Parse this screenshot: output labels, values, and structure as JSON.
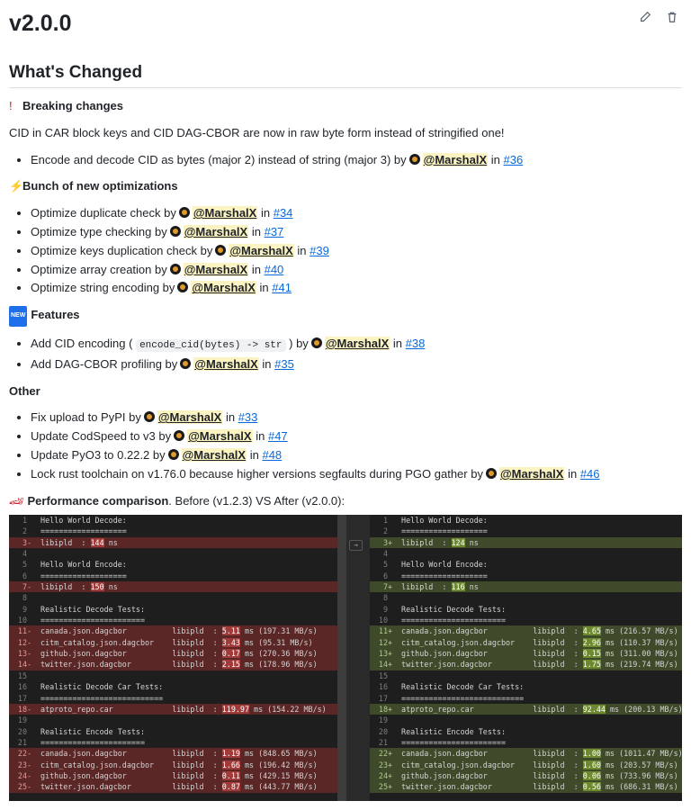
{
  "release": {
    "title": "v2.0.0"
  },
  "changes": {
    "heading": "What's Changed",
    "breaking": {
      "icon": "!",
      "title": "Breaking changes",
      "note": "CID in CAR block keys and CID DAG-CBOR are now in raw byte form instead of stringified one!",
      "items": [
        {
          "text": "Encode and decode CID as bytes (major 2) instead of string (major 3) by",
          "user": "@MarshalX",
          "in": "in",
          "pr": "#36"
        }
      ]
    },
    "optimizations": {
      "icon": "⚡",
      "title": "Bunch of new optimizations",
      "items": [
        {
          "text": "Optimize duplicate check by",
          "user": "@MarshalX",
          "in": "in",
          "pr": "#34"
        },
        {
          "text": "Optimize type checking by",
          "user": "@MarshalX",
          "in": "in",
          "pr": "#37"
        },
        {
          "text": "Optimize keys duplication check by",
          "user": "@MarshalX",
          "in": "in",
          "pr": "#39"
        },
        {
          "text": "Optimize array creation by",
          "user": "@MarshalX",
          "in": "in",
          "pr": "#40"
        },
        {
          "text": "Optimize string encoding by",
          "user": "@MarshalX",
          "in": "in",
          "pr": "#41"
        }
      ]
    },
    "features": {
      "icon": "NEW",
      "title": "Features",
      "items": [
        {
          "text_pre": "Add CID encoding (",
          "code": "encode_cid(bytes) -> str",
          "text_post": ") by",
          "user": "@MarshalX",
          "in": "in",
          "pr": "#38"
        },
        {
          "text": "Add DAG-CBOR profiling by",
          "user": "@MarshalX",
          "in": "in",
          "pr": "#35"
        }
      ]
    },
    "other": {
      "title": "Other",
      "items": [
        {
          "text": "Fix upload to PyPI by",
          "user": "@MarshalX",
          "in": "in",
          "pr": "#33"
        },
        {
          "text": "Update CodSpeed to v3 by",
          "user": "@MarshalX",
          "in": "in",
          "pr": "#47"
        },
        {
          "text": "Update PyO3 to 0.22.2 by",
          "user": "@MarshalX",
          "in": "in",
          "pr": "#48"
        },
        {
          "text": "Lock rust toolchain on v1.76.0 because higher versions segfaults during PGO gather by",
          "user": "@MarshalX",
          "in": "in",
          "pr": "#46"
        }
      ]
    },
    "performance": {
      "icon": "🏎",
      "title": "Performance comparison",
      "note": ". Before (v1.2.3) VS After (v2.0.0):"
    }
  },
  "diff": {
    "arrow": "→",
    "left": [
      {
        "n": "1",
        "t": "ctx",
        "s": "",
        "a": "Hello World Decode:",
        "h": "",
        "b": ""
      },
      {
        "n": "2",
        "t": "ctx",
        "s": "",
        "a": "===================",
        "h": "",
        "b": ""
      },
      {
        "n": "3",
        "t": "del",
        "s": "-",
        "a": "libipld  : ",
        "h": "144",
        "b": " ns"
      },
      {
        "n": "4",
        "t": "ctx",
        "s": "",
        "a": "",
        "h": "",
        "b": ""
      },
      {
        "n": "5",
        "t": "ctx",
        "s": "",
        "a": "Hello World Encode:",
        "h": "",
        "b": ""
      },
      {
        "n": "6",
        "t": "ctx",
        "s": "",
        "a": "===================",
        "h": "",
        "b": ""
      },
      {
        "n": "7",
        "t": "del",
        "s": "-",
        "a": "libipld  : ",
        "h": "150",
        "b": " ns"
      },
      {
        "n": "8",
        "t": "ctx",
        "s": "",
        "a": "",
        "h": "",
        "b": ""
      },
      {
        "n": "9",
        "t": "ctx",
        "s": "",
        "a": "Realistic Decode Tests:",
        "h": "",
        "b": ""
      },
      {
        "n": "10",
        "t": "ctx",
        "s": "",
        "a": "=======================",
        "h": "",
        "b": ""
      },
      {
        "n": "11",
        "t": "del",
        "s": "-",
        "a": "canada.json.dagcbor          libipld  : ",
        "h": "5.11",
        "b": " ms (197.31 MB/s)"
      },
      {
        "n": "12",
        "t": "del",
        "s": "-",
        "a": "citm_catalog.json.dagcbor    libipld  : ",
        "h": "3.43",
        "b": " ms (95.31 MB/s)"
      },
      {
        "n": "13",
        "t": "del",
        "s": "-",
        "a": "github.json.dagcbor          libipld  : ",
        "h": "0.17",
        "b": " ms (270.36 MB/s)"
      },
      {
        "n": "14",
        "t": "del",
        "s": "-",
        "a": "twitter.json.dagcbor         libipld  : ",
        "h": "2.15",
        "b": " ms (178.96 MB/s)"
      },
      {
        "n": "15",
        "t": "ctx",
        "s": "",
        "a": "",
        "h": "",
        "b": ""
      },
      {
        "n": "16",
        "t": "ctx",
        "s": "",
        "a": "Realistic Decode Car Tests:",
        "h": "",
        "b": ""
      },
      {
        "n": "17",
        "t": "ctx",
        "s": "",
        "a": "===========================",
        "h": "",
        "b": ""
      },
      {
        "n": "18",
        "t": "del",
        "s": "-",
        "a": "atproto_repo.car             libipld  : ",
        "h": "119.97",
        "b": " ms (154.22 MB/s)"
      },
      {
        "n": "19",
        "t": "ctx",
        "s": "",
        "a": "",
        "h": "",
        "b": ""
      },
      {
        "n": "20",
        "t": "ctx",
        "s": "",
        "a": "Realistic Encode Tests:",
        "h": "",
        "b": ""
      },
      {
        "n": "21",
        "t": "ctx",
        "s": "",
        "a": "=======================",
        "h": "",
        "b": ""
      },
      {
        "n": "22",
        "t": "del",
        "s": "-",
        "a": "canada.json.dagcbor          libipld  : ",
        "h": "1.19",
        "b": " ms (848.65 MB/s)"
      },
      {
        "n": "23",
        "t": "del",
        "s": "-",
        "a": "citm_catalog.json.dagcbor    libipld  : ",
        "h": "1.66",
        "b": " ms (196.42 MB/s)"
      },
      {
        "n": "24",
        "t": "del",
        "s": "-",
        "a": "github.json.dagcbor          libipld  : ",
        "h": "0.11",
        "b": " ms (429.15 MB/s)"
      },
      {
        "n": "25",
        "t": "del",
        "s": "-",
        "a": "twitter.json.dagcbor         libipld  : ",
        "h": "0.87",
        "b": " ms (443.77 MB/s)"
      }
    ],
    "right": [
      {
        "n": "1",
        "t": "ctx",
        "s": "",
        "a": "Hello World Decode:",
        "h": "",
        "b": ""
      },
      {
        "n": "2",
        "t": "ctx",
        "s": "",
        "a": "===================",
        "h": "",
        "b": ""
      },
      {
        "n": "3",
        "t": "add",
        "s": "+",
        "a": "libipld  : ",
        "h": "124",
        "b": " ns"
      },
      {
        "n": "4",
        "t": "ctx",
        "s": "",
        "a": "",
        "h": "",
        "b": ""
      },
      {
        "n": "5",
        "t": "ctx",
        "s": "",
        "a": "Hello World Encode:",
        "h": "",
        "b": ""
      },
      {
        "n": "6",
        "t": "ctx",
        "s": "",
        "a": "===================",
        "h": "",
        "b": ""
      },
      {
        "n": "7",
        "t": "add",
        "s": "+",
        "a": "libipld  : ",
        "h": "116",
        "b": " ns"
      },
      {
        "n": "8",
        "t": "ctx",
        "s": "",
        "a": "",
        "h": "",
        "b": ""
      },
      {
        "n": "9",
        "t": "ctx",
        "s": "",
        "a": "Realistic Decode Tests:",
        "h": "",
        "b": ""
      },
      {
        "n": "10",
        "t": "ctx",
        "s": "",
        "a": "=======================",
        "h": "",
        "b": ""
      },
      {
        "n": "11",
        "t": "add",
        "s": "+",
        "a": "canada.json.dagcbor          libipld  : ",
        "h": "4.65",
        "b": " ms (216.57 MB/s)"
      },
      {
        "n": "12",
        "t": "add",
        "s": "+",
        "a": "citm_catalog.json.dagcbor    libipld  : ",
        "h": "2.96",
        "b": " ms (110.37 MB/s)"
      },
      {
        "n": "13",
        "t": "add",
        "s": "+",
        "a": "github.json.dagcbor          libipld  : ",
        "h": "0.15",
        "b": " ms (311.00 MB/s)"
      },
      {
        "n": "14",
        "t": "add",
        "s": "+",
        "a": "twitter.json.dagcbor         libipld  : ",
        "h": "1.75",
        "b": " ms (219.74 MB/s)"
      },
      {
        "n": "15",
        "t": "ctx",
        "s": "",
        "a": "",
        "h": "",
        "b": ""
      },
      {
        "n": "16",
        "t": "ctx",
        "s": "",
        "a": "Realistic Decode Car Tests:",
        "h": "",
        "b": ""
      },
      {
        "n": "17",
        "t": "ctx",
        "s": "",
        "a": "===========================",
        "h": "",
        "b": ""
      },
      {
        "n": "18",
        "t": "add",
        "s": "+",
        "a": "atproto_repo.car             libipld  : ",
        "h": "92.44",
        "b": " ms (200.13 MB/s)"
      },
      {
        "n": "19",
        "t": "ctx",
        "s": "",
        "a": "",
        "h": "",
        "b": ""
      },
      {
        "n": "20",
        "t": "ctx",
        "s": "",
        "a": "Realistic Encode Tests:",
        "h": "",
        "b": ""
      },
      {
        "n": "21",
        "t": "ctx",
        "s": "",
        "a": "=======================",
        "h": "",
        "b": ""
      },
      {
        "n": "22",
        "t": "add",
        "s": "+",
        "a": "canada.json.dagcbor          libipld  : ",
        "h": "1.00",
        "b": " ms (1011.47 MB/s)"
      },
      {
        "n": "23",
        "t": "add",
        "s": "+",
        "a": "citm_catalog.json.dagcbor    libipld  : ",
        "h": "1.60",
        "b": " ms (203.57 MB/s)"
      },
      {
        "n": "24",
        "t": "add",
        "s": "+",
        "a": "github.json.dagcbor          libipld  : ",
        "h": "0.06",
        "b": " ms (733.96 MB/s)"
      },
      {
        "n": "25",
        "t": "add",
        "s": "+",
        "a": "twitter.json.dagcbor         libipld  : ",
        "h": "0.56",
        "b": " ms (686.31 MB/s)"
      }
    ]
  }
}
